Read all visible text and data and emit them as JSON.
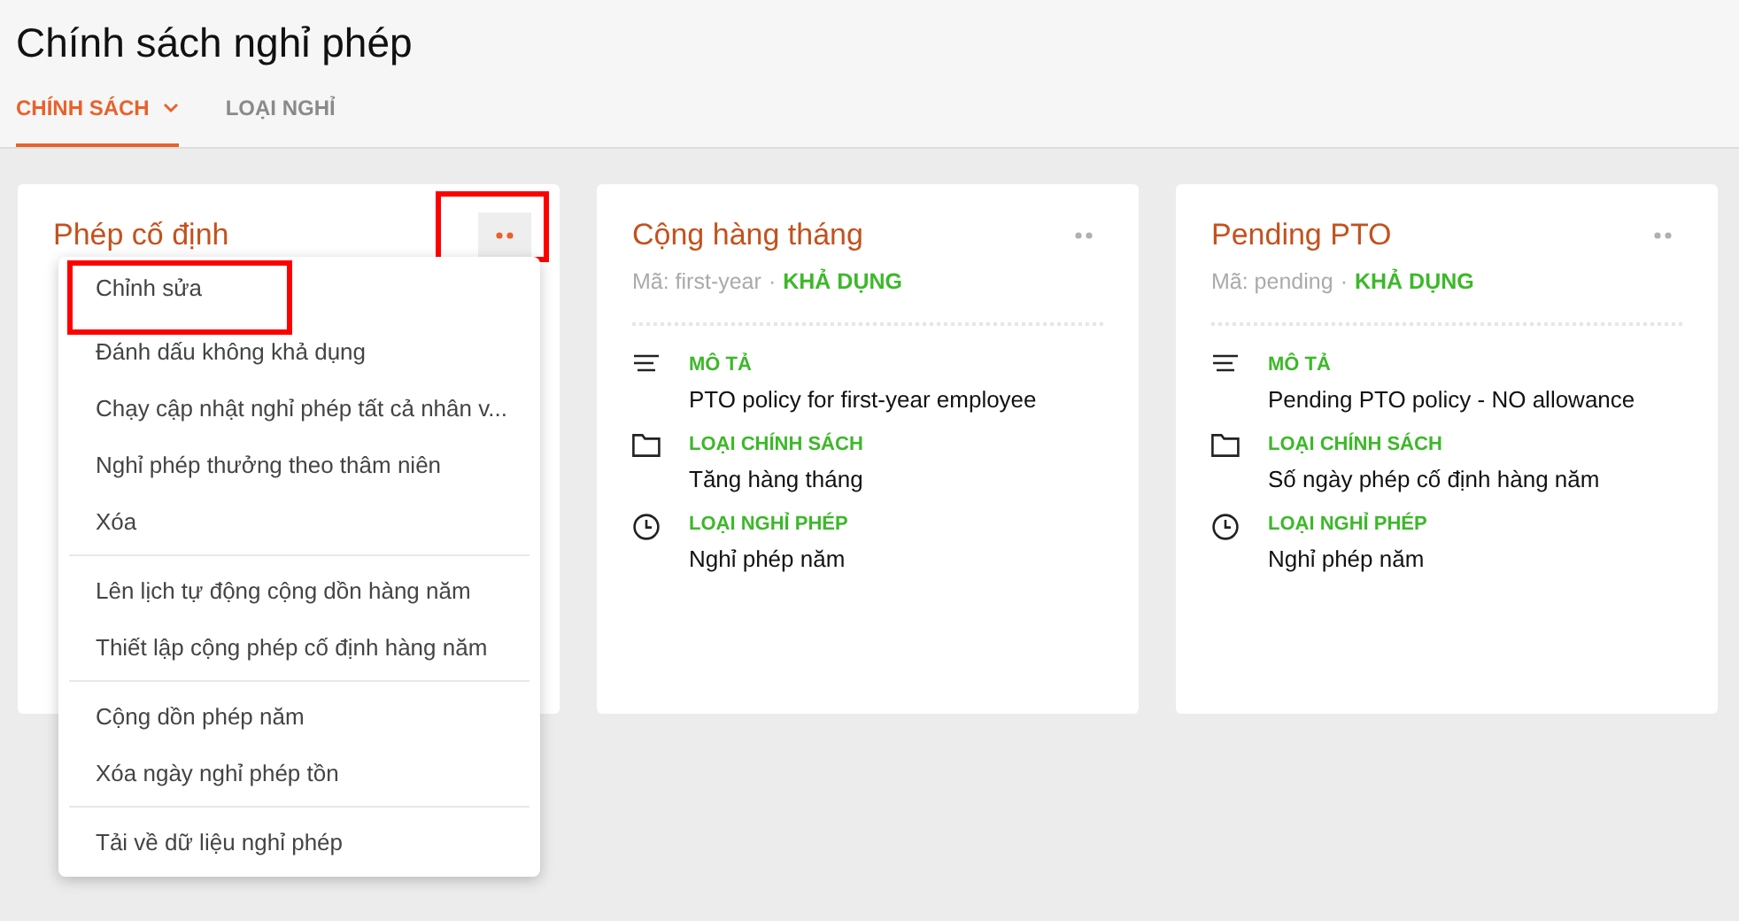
{
  "page": {
    "title": "Chính sách nghỉ phép"
  },
  "tabs": [
    {
      "label": "CHÍNH SÁCH",
      "selected": true,
      "dropdown": true
    },
    {
      "label": "LOẠI NGHỈ",
      "selected": false,
      "dropdown": false
    }
  ],
  "cards": [
    {
      "title": "Phép cố định",
      "menu_open": true,
      "highlighted": true
    },
    {
      "title": "Cộng hàng tháng",
      "menu_open": false,
      "highlighted": false,
      "code": "Mã: first-year",
      "separator": "·",
      "status": "KHẢ DỤNG",
      "fields": [
        {
          "kind": "description",
          "label": "MÔ TẢ",
          "value": "PTO policy for first-year employee"
        },
        {
          "kind": "policy",
          "label": "LOẠI CHÍNH SÁCH",
          "value": "Tăng hàng tháng"
        },
        {
          "kind": "leave",
          "label": "LOẠI NGHỈ PHÉP",
          "value": "Nghỉ phép năm"
        }
      ]
    },
    {
      "title": "Pending PTO",
      "menu_open": false,
      "highlighted": false,
      "code": "Mã: pending",
      "separator": "·",
      "status": "KHẢ DỤNG",
      "fields": [
        {
          "kind": "description",
          "label": "MÔ TẢ",
          "value": "Pending PTO policy - NO allowance"
        },
        {
          "kind": "policy",
          "label": "LOẠI CHÍNH SÁCH",
          "value": "Số ngày phép cố định hàng năm"
        },
        {
          "kind": "leave",
          "label": "LOẠI NGHỈ PHÉP",
          "value": "Nghỉ phép năm"
        }
      ]
    }
  ],
  "menu": {
    "groups": [
      [
        {
          "label": "Chỉnh sửa",
          "highlighted": true
        },
        {
          "label": "Đánh dấu không khả dụng",
          "highlighted": false
        },
        {
          "label": "Chạy cập nhật nghỉ phép tất cả nhân v...",
          "highlighted": false
        },
        {
          "label": "Nghỉ phép thưởng theo thâm niên",
          "highlighted": false
        },
        {
          "label": "Xóa",
          "highlighted": false
        }
      ],
      [
        {
          "label": "Lên lịch tự động cộng dồn hàng năm",
          "highlighted": false
        },
        {
          "label": "Thiết lập cộng phép cố định hàng năm",
          "highlighted": false
        }
      ],
      [
        {
          "label": "Cộng dồn phép năm",
          "highlighted": false
        },
        {
          "label": "Xóa ngày nghỉ phép tồn",
          "highlighted": false
        }
      ],
      [
        {
          "label": "Tải về dữ liệu nghỉ phép",
          "highlighted": false
        }
      ]
    ]
  }
}
